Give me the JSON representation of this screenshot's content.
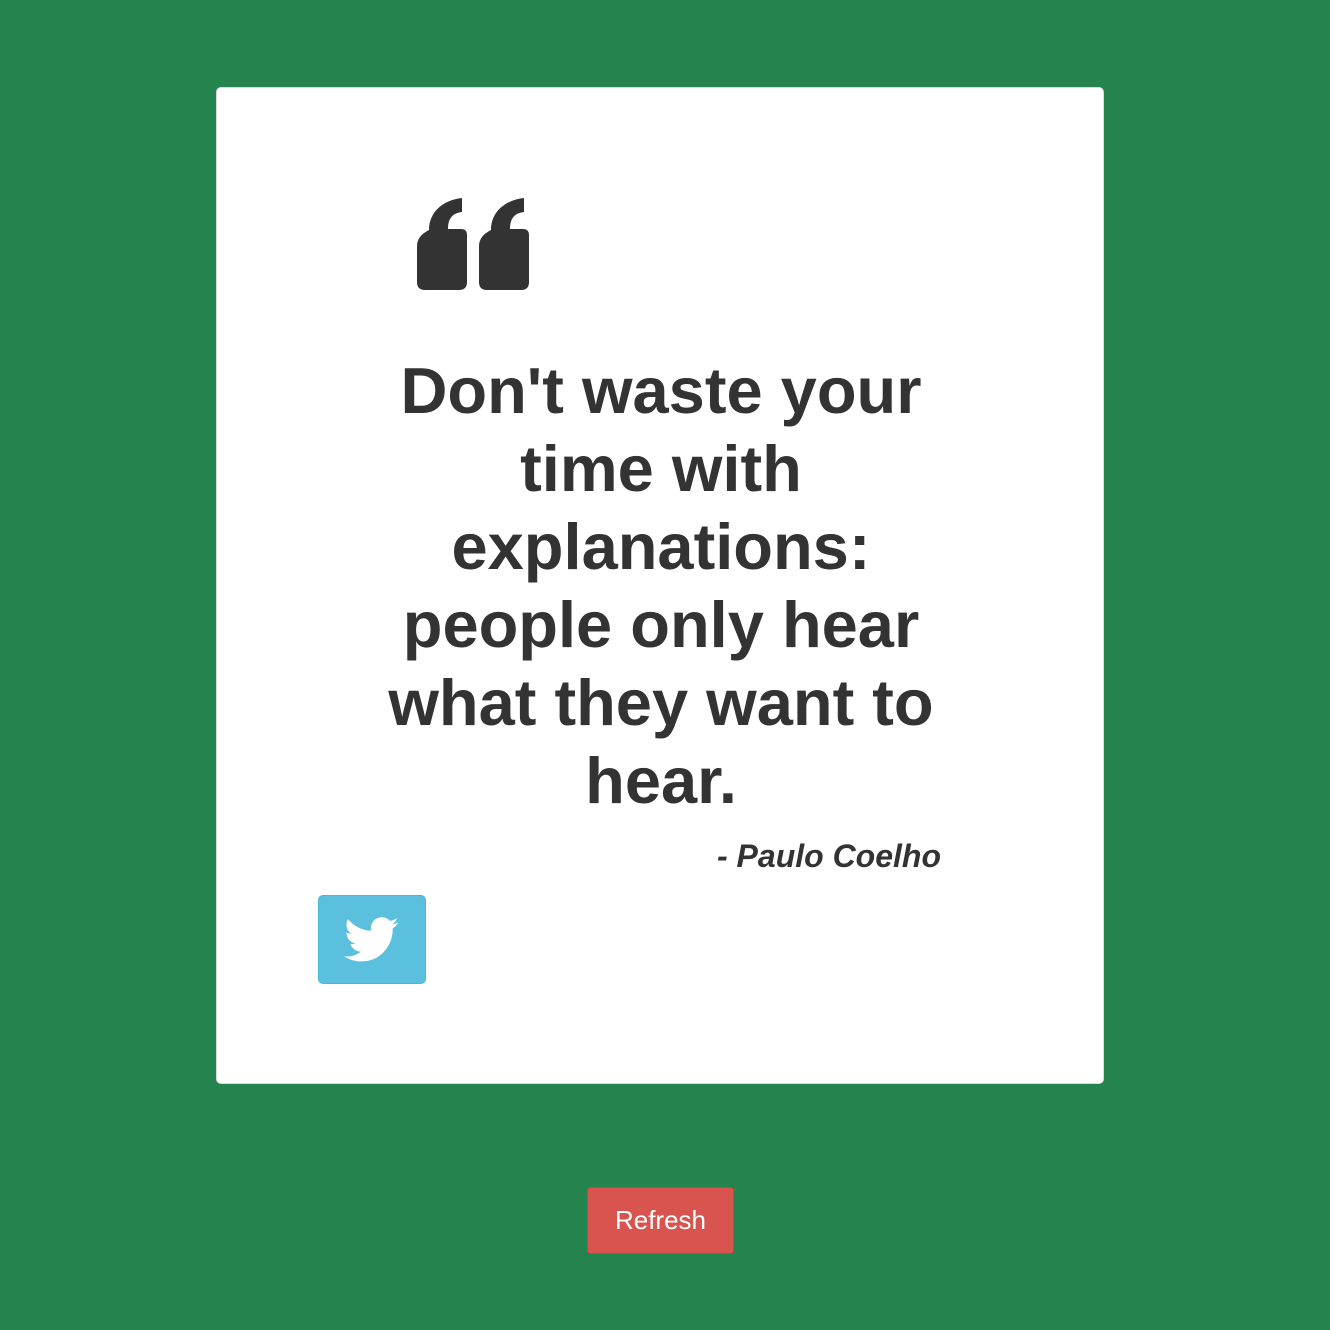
{
  "colors": {
    "background": "#25834e",
    "card": "#ffffff",
    "text": "#333333",
    "tweet_button": "#5bc0de",
    "refresh_button": "#d9534f"
  },
  "quote": {
    "icon": "quote-left-icon",
    "text": "Don't waste your time with explanations: people only hear what they want to hear.",
    "author": "- Paulo Coelho"
  },
  "actions": {
    "tweet_icon": "twitter-icon",
    "refresh_label": "Refresh"
  }
}
